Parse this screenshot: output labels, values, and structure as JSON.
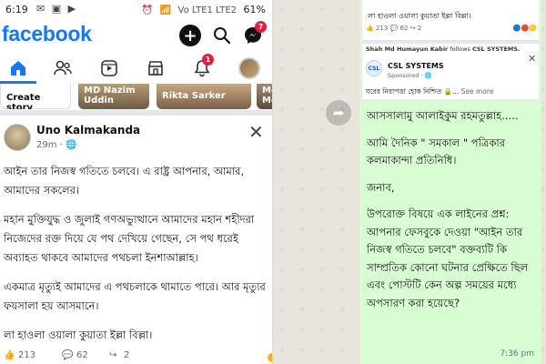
{
  "facebook": {
    "status_bar": {
      "time": "6:19",
      "battery": "61%",
      "network_label": "Vo LTE1 LTE2"
    },
    "logo": "facebook",
    "header": {
      "messenger_badge": "7"
    },
    "nav": {
      "notifications_badge": "1"
    },
    "stories": {
      "create_label": "Create story",
      "items": [
        "MD Nazim Uddin",
        "Rikta Sarker",
        "Mo Mo"
      ]
    },
    "post": {
      "author": "Uno Kalmakanda",
      "time": "29m",
      "paragraphs": [
        "আইন তার নিজস্ব গতিতে চলবে। এ রাষ্ট্র আপনার, আমার, আমাদের সকলের।",
        "মহান মুক্তিযুদ্ধ ও জুলাই গণঅভ্যুত্থানে আমাদের মহান শহীদরা নিজেদের রক্ত দিয়ে যে পথ দেখিয়ে গেছেন, সে পথ ধরেই অব্যাহত থাকবে আমাদের পথচলা ইনশাআল্লাহ।",
        "একমাত্র মৃত্যুই আমাদের এ পথচলাকে থামাতে পারে। আর মৃত্যুর ফয়সালা হয় আসমানে।",
        "লা হাওলা ওয়ালা কুয়াতা ইল্লা বিল্লা।"
      ],
      "likes": "213",
      "comments": "62",
      "shares": "2"
    }
  },
  "whatsapp": {
    "forwarded_image": {
      "top_text": "লা হাওলা ওয়ালা কুয়াতা ইল্লা বিল্লা।",
      "likes": "213",
      "comments": "62",
      "shares": "2",
      "follow_name": "Shah Md Humayun Kabir",
      "follow_text": "follows",
      "follow_target": "CSL SYSTEMS.",
      "ad_title": "CSL SYSTEMS",
      "ad_logo": "CSL",
      "sponsored": "Sponsored · 🌐",
      "ad_text": "ঘরের নিরাপত্তা হোক নিশ্চিত 🔒...",
      "see_more": "See more"
    },
    "message": {
      "paragraphs": [
        "আসসালামু আলাইকুম রহমতুল্লাহ.....",
        "আমি দৈনিক \" সমকাল \" পত্রিকার কলমাকান্দা প্রতিনিধি।",
        "জনাব,",
        "উপরোক্ত বিষয়ে এক লাইনের প্রশ্ন: আপনার ফেসবুকে দেওয়া \"আইন তার নিজস্ব গতিতে চলবে\" বক্তব্যটি কি সাম্প্রতিক কোনো ঘটনার প্রেক্ষিতে ছিল এবং পোস্টটি কেন অল্প সময়ের মধ্যে অপসারণ করা হয়েছে?"
      ],
      "time": "7:36 pm"
    }
  },
  "colors": {
    "fb_blue": "#1877f2",
    "badge_red": "#e41e3f",
    "wa_bubble": "#d9fdd3",
    "wa_background": "#e9e4dc"
  }
}
